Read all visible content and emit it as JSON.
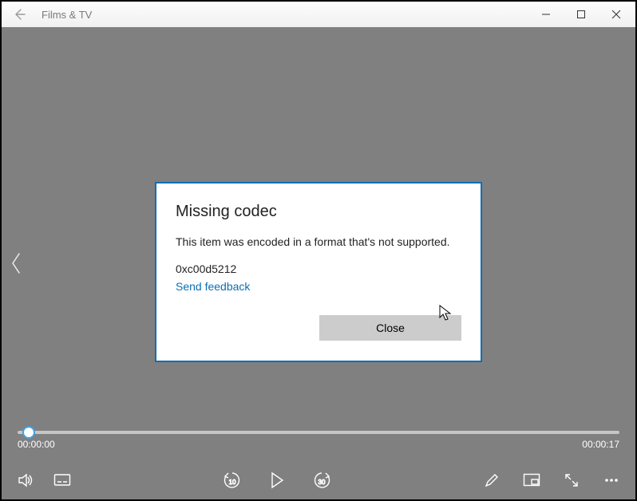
{
  "titlebar": {
    "app_name": "Films & TV"
  },
  "timeline": {
    "current": "00:00:00",
    "duration": "00:00:17"
  },
  "dialog": {
    "title": "Missing codec",
    "message": "This item was encoded in a format that's not supported.",
    "error_code": "0xc00d5212",
    "feedback_link": "Send feedback",
    "close_label": "Close"
  }
}
